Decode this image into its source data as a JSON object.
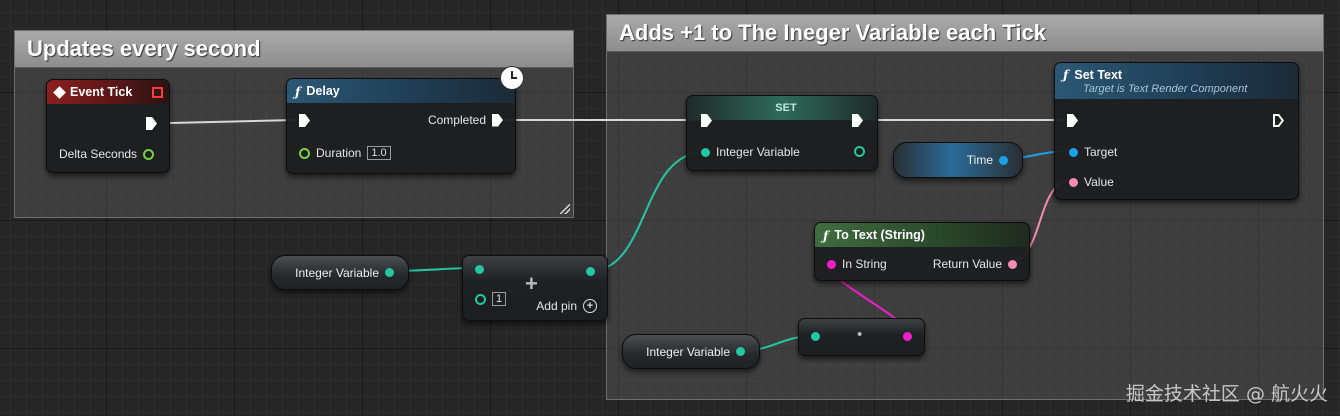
{
  "comments": {
    "left_title": "Updates every second",
    "right_title": "Adds +1 to The Ineger Variable each Tick"
  },
  "event_tick": {
    "title": "Event Tick",
    "delta_label": "Delta Seconds"
  },
  "delay": {
    "title": "Delay",
    "completed_label": "Completed",
    "duration_label": "Duration",
    "duration_value": "1.0"
  },
  "set_node": {
    "title": "SET",
    "var_label": "Integer Variable"
  },
  "set_text": {
    "title": "Set Text",
    "subtitle": "Target is Text Render Component",
    "target_label": "Target",
    "value_label": "Value"
  },
  "time_node": {
    "label": "Time"
  },
  "to_text": {
    "title": "To Text (String)",
    "in_label": "In String",
    "out_label": "Return Value"
  },
  "integer_var_1": {
    "label": "Integer Variable"
  },
  "integer_var_2": {
    "label": "Integer Variable"
  },
  "add_node": {
    "operator": "+",
    "input_value": "1",
    "add_pin_label": "Add pin"
  },
  "append_node": {
    "operator": "•"
  },
  "icons": [
    "event-icon",
    "function-icon",
    "clock-icon",
    "add-pin-icon"
  ],
  "colors": {
    "exec": "#ffffff",
    "integer": "#23c7a0",
    "object": "#1aa2e8",
    "text": "#f48cb2",
    "string": "#f01ec8",
    "float": "#76d242"
  },
  "watermark": "掘金技术社区 @ 航火火"
}
